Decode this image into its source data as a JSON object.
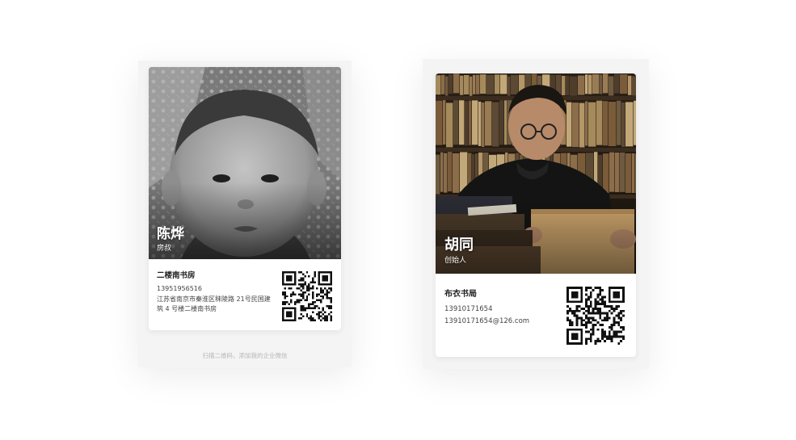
{
  "cards": [
    {
      "name": "陈烨",
      "title": "房叔",
      "company": "二楼南书房",
      "phone": "13951956516",
      "address_line1": "江苏省南京市秦淮区秣陵路 21号民国建",
      "address_line2": "筑 4 号楼二楼南书房",
      "photo_icon": "baby-portrait-photo",
      "qr_icon": "qr-code-icon",
      "footer_hint": "扫描二维码，添加我的企业微信"
    },
    {
      "name": "胡同",
      "title": "创始人",
      "company": "布衣书局",
      "phone": "13910171654",
      "email": "13910171654@126.com",
      "photo_icon": "man-with-book-photo",
      "qr_icon": "qr-code-icon"
    }
  ],
  "colors": {
    "page_background": "#ffffff",
    "panel_background": "#f4f4f5",
    "card_background": "#ffffff",
    "hint_text": "#b6b6b6"
  }
}
